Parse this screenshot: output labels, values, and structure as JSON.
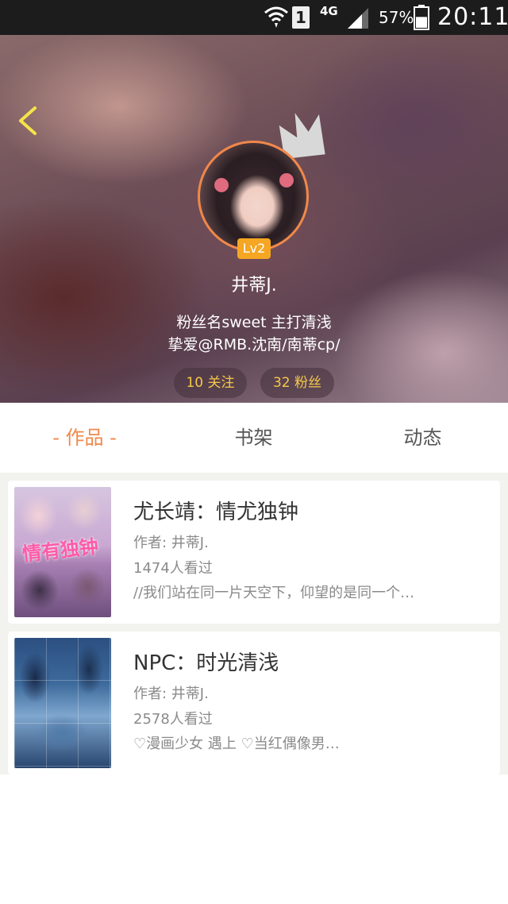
{
  "status_bar": {
    "sim_slot": "1",
    "network": "4G",
    "battery_percent": "57%",
    "battery_level": 0.57,
    "time": "20:11",
    "icons": [
      "wifi-icon",
      "sim-icon",
      "signal-icon",
      "battery-icon"
    ]
  },
  "profile": {
    "back_icon": "chevron-left-icon",
    "crown_icon": "crown-icon",
    "level": "Lv2",
    "username": "井蒂J.",
    "bio_line1": "粉丝名sweet  主打清浅",
    "bio_line2": "挚爱@RMB.沈南/南蒂cp/",
    "following_label": "10 关注",
    "fans_label": "32 粉丝",
    "colors": {
      "accent": "#f0884a",
      "level_badge": "#f5a623",
      "stat_text": "#f7c84a"
    }
  },
  "tabs": [
    {
      "label": "- 作品 -",
      "active": true
    },
    {
      "label": "书架",
      "active": false
    },
    {
      "label": "动态",
      "active": false
    }
  ],
  "works": [
    {
      "cover_text": "情有独钟",
      "title": "尤长靖：情尤独钟",
      "author": "作者: 井蒂J.",
      "views": "1474人看过",
      "description": "//我们站在同一片天空下，仰望的是同一个…"
    },
    {
      "title": "NPC：时光清浅",
      "author": "作者: 井蒂J.",
      "views": "2578人看过",
      "description": "♡漫画少女 遇上 ♡当红偶像男…"
    }
  ]
}
